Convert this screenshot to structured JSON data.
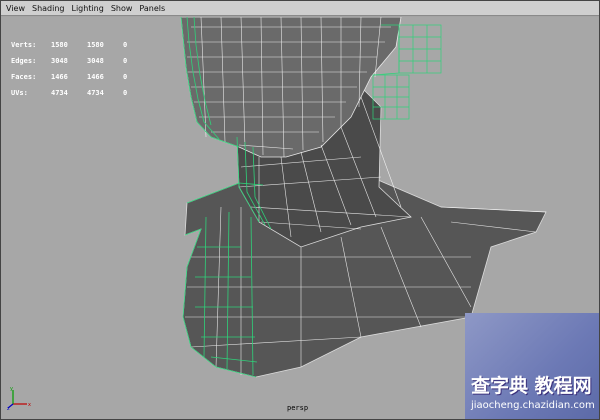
{
  "menu": [
    "View",
    "Shading",
    "Lighting",
    "Show",
    "Panels"
  ],
  "hud": {
    "rows": [
      {
        "label": "Verts:",
        "a": "1580",
        "b": "1580",
        "c": "0"
      },
      {
        "label": "Edges:",
        "a": "3048",
        "b": "3048",
        "c": "0"
      },
      {
        "label": "Faces:",
        "a": "1466",
        "b": "1466",
        "c": "0"
      },
      {
        "label": "UVs:",
        "a": "4734",
        "b": "4734",
        "c": "0"
      }
    ]
  },
  "camera": "persp",
  "watermark": {
    "main": "查字典 教程网",
    "sub": "jiaocheng.chazidian.com"
  },
  "colors": {
    "menubar": "#cfcfcf",
    "viewport_bg": "#a7a7a7",
    "mesh_fill": "#5a5a5a",
    "wire": "#ffffff",
    "selected_wire": "#2fd27a",
    "watermark_bg": "#6c79b5"
  }
}
